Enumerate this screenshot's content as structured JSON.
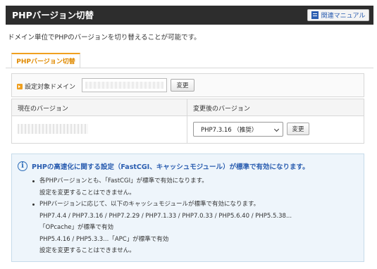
{
  "header": {
    "title": "PHPバージョン切替",
    "manual_label": "関連マニュアル"
  },
  "description": "ドメイン単位でPHPのバージョンを切り替えることが可能です。",
  "tab": {
    "label": "PHPバージョン切替"
  },
  "domain_row": {
    "label": "設定対象ドメイン",
    "domain_value": "",
    "change_button": "変更"
  },
  "version_table": {
    "current_header": "現在のバージョン",
    "new_header": "変更後のバージョン",
    "current_value": "",
    "selected_option": "PHP7.3.16 （推奨）",
    "change_button": "変更"
  },
  "info": {
    "title": "PHPの高速化に関する設定（FastCGI、キャッシュモジュール）が標準で有効になります。",
    "items": [
      {
        "line1": "各PHPバージョンとも、「FastCGI」が標準で有効になります。",
        "line2": "設定を変更することはできません。"
      },
      {
        "line1": "PHPバージョンに応じて、以下のキャッシュモジュールが標準で有効になります。",
        "line2": "PHP7.4.4 / PHP7.3.16 / PHP7.2.29 / PHP7.1.33 / PHP7.0.33 / PHP5.6.40 / PHP5.5.38...",
        "line3": "「OPcache」が標準で有効",
        "line4": "PHP5.4.16 / PHP5.3.3...「APC」が標準で有効",
        "line5": "設定を変更することはできません。"
      }
    ]
  },
  "colors": {
    "header_bg": "#2d2d2d",
    "accent_orange": "#f0a020",
    "link_blue": "#2a5db0",
    "info_bg": "#eef5fb"
  }
}
